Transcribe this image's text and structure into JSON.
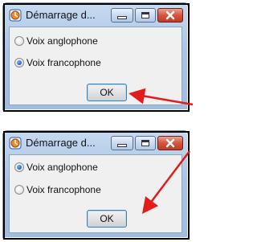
{
  "dialogs": [
    {
      "title": "Démarrage d...",
      "options": [
        {
          "label": "Voix anglophone",
          "checked": false
        },
        {
          "label": "Voix francophone",
          "checked": true
        }
      ],
      "ok_label": "OK"
    },
    {
      "title": "Démarrage d...",
      "options": [
        {
          "label": "Voix anglophone",
          "checked": true
        },
        {
          "label": "Voix francophone",
          "checked": false
        }
      ],
      "ok_label": "OK"
    }
  ],
  "colors": {
    "arrow": "#e31b1b",
    "frame": "#000000",
    "close_button": "#c23a22",
    "titlebar": "#a9c5e6"
  },
  "icons": [
    "app-icon",
    "minimize-icon",
    "maximize-icon",
    "close-icon",
    "arrow-annotation"
  ]
}
